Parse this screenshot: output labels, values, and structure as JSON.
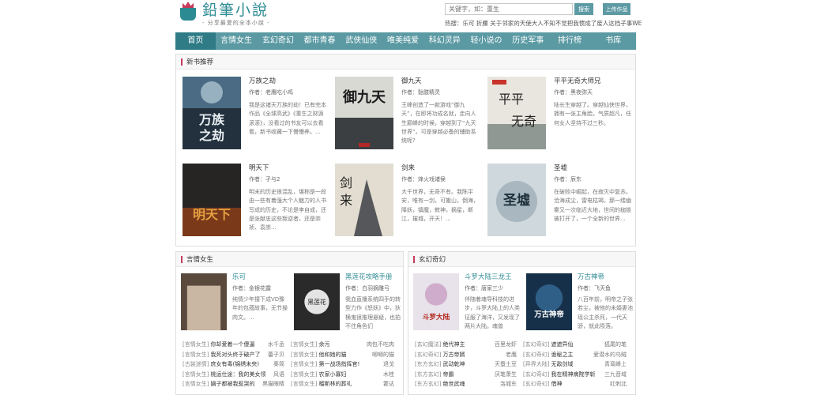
{
  "site": {
    "logo_title": "鉛筆小說",
    "logo_sub": "- 分享最愛的全本小說 -"
  },
  "search": {
    "placeholder": "关键字，如：重生",
    "button": "搜索",
    "upload": "上传作品",
    "hot_text": "热搜：乐可 折腰 关于邻家的天使大人不知不觉把我惯成了废人这档子事WE"
  },
  "nav": [
    "首页",
    "言情女生",
    "玄幻奇幻",
    "都市青春",
    "武侠仙侠",
    "唯美纯爱",
    "科幻灵异",
    "轻小说の",
    "历史军事",
    "排行榜",
    "书库"
  ],
  "new_books": {
    "title": "新书推荐",
    "books": [
      {
        "name": "万族之劫",
        "author": "作者：老鹰吃小鸡",
        "desc": "我是这诸天万族的劫！已有完本作品《全球高武》《重生之财源滚滚》，没看过的书友可以去看看，新书收藏一下慢慢养。..."
      },
      {
        "name": "御九天",
        "author": "作者：骷髅精灵",
        "desc": "王峰创造了一款游戏“御九天”，在即将功成名就，走向人生巅峰的时候，穿越到了“九天世界”。可是穿越必备的辅助系统呢?"
      },
      {
        "name": "平平无奇大师兄",
        "author": "作者：黑夜弥天",
        "desc": "陆长生穿越了。穿越仙侠世界，拥有一张主角脸。气质超凡，任何女人坚持不过三秒。"
      },
      {
        "name": "明天下",
        "author": "作者：孑与2",
        "desc": "明末的历史很混乱，堪称是一段由一些有着强大个人魅力的人书写成的历史，不论是李自成，还是张献忠这些叛逆者，还是崇祯、袁崇..."
      },
      {
        "name": "剑来",
        "author": "作者：烽火戏诸侯",
        "desc": "大千世界，无奇不有。我陈平安，唯有一剑，可搬山，倒海，降妖，镇魔，敕神，摘星，断江，摧城，开天！..."
      },
      {
        "name": "圣墟",
        "author": "作者：辰东",
        "desc": "在破败中崛起，在寂灭中复苏。沧海成尘，雷电枯竭，那一缕幽雾又一次临近大地，世间的枷锁被打开了，一个全新的世界..."
      }
    ]
  },
  "yanqing": {
    "title": "言情女生",
    "books": [
      {
        "name": "乐可",
        "author": "作者：金银花露",
        "desc": "纯情少年撞下成VD豫年的包蕴故事，无节操肉文。..."
      },
      {
        "name": "黑莲花攻略手册",
        "author": "作者：白羽摘雕弓",
        "desc": "我血直播系统四手的转型力作《怒妖》中，狄横鬼很推理悬疑，也拍不住角色们"
      }
    ],
    "list": [
      {
        "cat": "[言情女生]",
        "title": "你却爱着一个傻逼",
        "author": "水千丞"
      },
      {
        "cat": "[言情女生]",
        "title": "余污",
        "author": "肉包不吃肉"
      },
      {
        "cat": "[言情女生]",
        "title": "我死对头终于破产了",
        "author": "蕾子贝"
      },
      {
        "cat": "[言情女生]",
        "title": "他和她的猫",
        "author": "唧唧的猫"
      },
      {
        "cat": "[古装迷情]",
        "title": "庶女有毒(锦绣未央)",
        "author": "秦简"
      },
      {
        "cat": "[言情女生]",
        "title": "第一战场指挥官!",
        "author": "退戈"
      },
      {
        "cat": "[言情女生]",
        "title": "桃运仕途：我的美女领",
        "author": "风语"
      },
      {
        "cat": "[言情女生]",
        "title": "农家小寡妇",
        "author": "木桂"
      },
      {
        "cat": "[言情女生]",
        "title": "嫡子都被我惹哭的",
        "author": "黑猫眼睛"
      },
      {
        "cat": "[言情女生]",
        "title": "榴斯林的葬礼",
        "author": "霍达"
      }
    ]
  },
  "xuanhuan": {
    "title": "玄幻奇幻",
    "books": [
      {
        "name": "斗罗大陆三龙王",
        "author": "作者：唐家三少",
        "desc": "伴随着魂导科技的进步，斗罗大陆上的人类征服了海洋，又发现了两片大陆。魂兽"
      },
      {
        "name": "万古神帝",
        "author": "作者：飞天鱼",
        "desc": "八百年前，明帝之子张若尘，被他的未婚妻池瑶公主杀死，一代天骄，就此陨落。"
      }
    ],
    "list": [
      {
        "cat": "[玄幻魔法]",
        "title": "绝代神主",
        "author": "百里龙虾"
      },
      {
        "cat": "[玄幻奇幻]",
        "title": "遮遮异仙",
        "author": "狐尾的笔"
      },
      {
        "cat": "[玄幻奇幻]",
        "title": "万古帝婿",
        "author": "老鹰"
      },
      {
        "cat": "[玄幻奇幻]",
        "title": "诡秘之主",
        "author": "爱潜水的乌贼"
      },
      {
        "cat": "[东方玄幻]",
        "title": "武动乾坤",
        "author": "天蚕土豆"
      },
      {
        "cat": "[异界大陆]",
        "title": "无敌剑域",
        "author": "青鸾峰上"
      },
      {
        "cat": "[东方玄幻]",
        "title": "帝霸",
        "author": "厌笔萧生"
      },
      {
        "cat": "[玄幻奇幻]",
        "title": "我在精神病院学斩",
        "author": "三九音域"
      },
      {
        "cat": "[东方玄幻]",
        "title": "绝世武魂",
        "author": "洛城东"
      },
      {
        "cat": "[玄幻奇幻]",
        "title": "借神",
        "author": "红刺北"
      }
    ]
  }
}
